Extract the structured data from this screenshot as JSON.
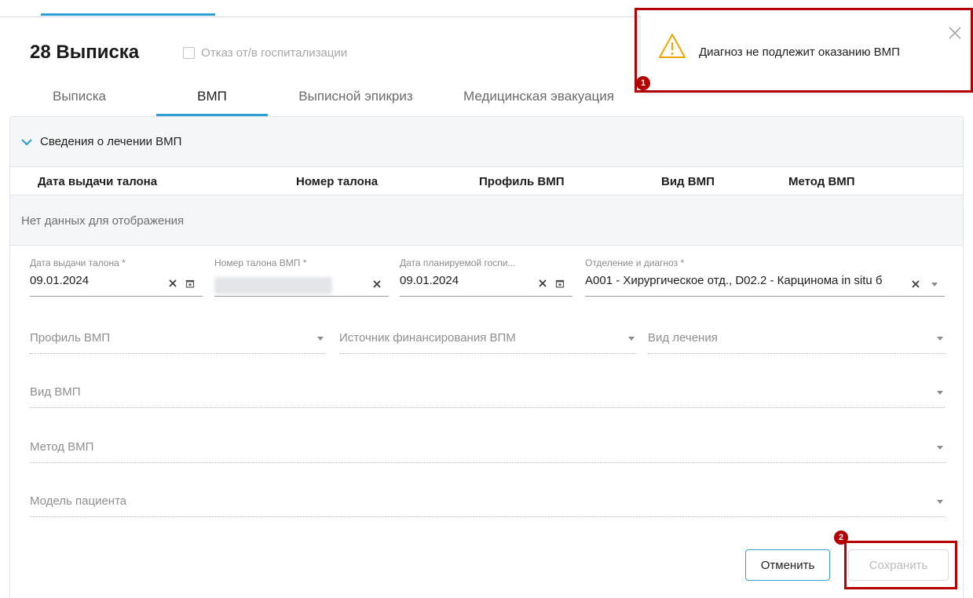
{
  "header": {
    "title": "28 Выписка",
    "refusal_checkbox_label": "Отказ от/в госпитализации"
  },
  "tabs": [
    {
      "label": "Выписка",
      "active": false
    },
    {
      "label": "ВМП",
      "active": true
    },
    {
      "label": "Выписной эпикриз",
      "active": false
    },
    {
      "label": "Медицинская эвакуация",
      "active": false
    }
  ],
  "accordion": {
    "title": "Сведения о лечении ВМП",
    "expanded": true
  },
  "grid": {
    "columns": [
      "Дата выдачи талона",
      "Номер талона",
      "Профиль ВМП",
      "Вид ВМП",
      "Метод ВМП"
    ],
    "empty_text": "Нет данных для отображения"
  },
  "form": {
    "issue_date": {
      "label": "Дата выдачи талона *",
      "value": "09.01.2024"
    },
    "voucher_number": {
      "label": "Номер талона ВМП *",
      "value": ""
    },
    "planned_date": {
      "label": "Дата планируемой госпи...",
      "value": "09.01.2024"
    },
    "department_diagnosis": {
      "label": "Отделение и диагноз *",
      "value": "А001 - Хирургическое отд., D02.2 - Карцинома in situ б"
    },
    "vmp_profile": {
      "placeholder": "Профиль ВМП"
    },
    "funding_source": {
      "placeholder": "Источник финансирования ВПМ"
    },
    "treatment_type": {
      "placeholder": "Вид лечения"
    },
    "vmp_type": {
      "placeholder": "Вид ВМП"
    },
    "vmp_method": {
      "placeholder": "Метод ВМП"
    },
    "patient_model": {
      "placeholder": "Модель пациента"
    }
  },
  "buttons": {
    "cancel": "Отменить",
    "save": "Сохранить"
  },
  "notification": {
    "text": "Диагноз не подлежит оказанию ВМП",
    "icon": "warning-icon"
  },
  "annotations": {
    "badge_1": "1",
    "badge_2": "2",
    "highlight_color": "#b30000"
  },
  "colors": {
    "accent": "#2e9ed6",
    "warning": "#f0a500"
  }
}
